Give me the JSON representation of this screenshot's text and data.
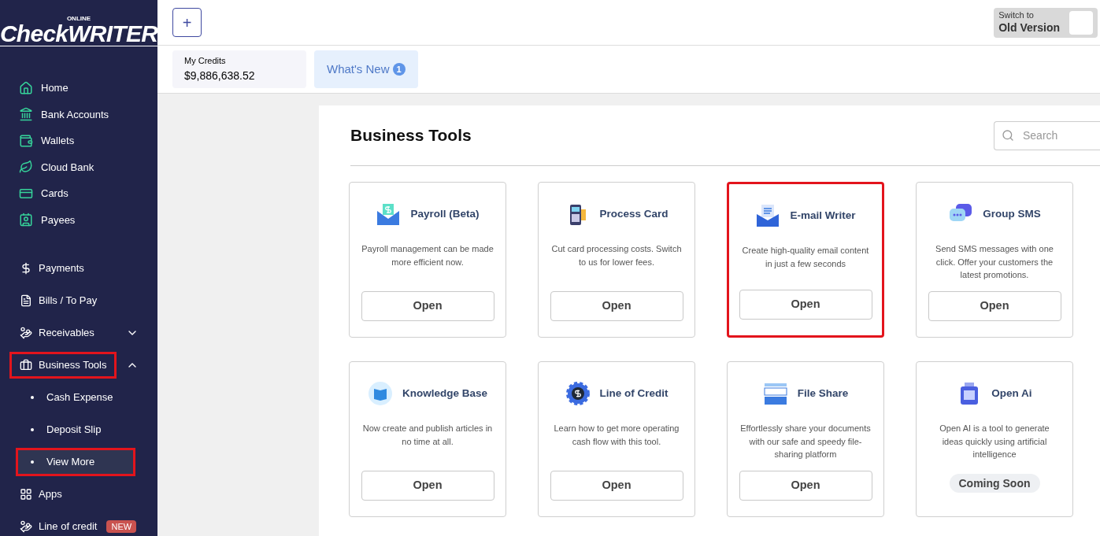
{
  "logo": {
    "small": "ONLINE",
    "main": "CheckWRITER"
  },
  "sidebar": {
    "primary": [
      {
        "label": "Home"
      },
      {
        "label": "Bank Accounts"
      },
      {
        "label": "Wallets"
      },
      {
        "label": "Cloud Bank"
      },
      {
        "label": "Cards"
      },
      {
        "label": "Payees"
      }
    ],
    "secondary": [
      {
        "label": "Payments",
        "kind": "link",
        "highlighted": false
      },
      {
        "label": "Bills / To Pay",
        "kind": "link",
        "highlighted": false
      },
      {
        "label": "Receivables",
        "kind": "group",
        "expanded": false,
        "highlighted": false
      },
      {
        "label": "Business Tools",
        "kind": "group",
        "expanded": true,
        "highlighted": true,
        "children": [
          {
            "label": "Cash Expense",
            "selected": false,
            "highlighted": false
          },
          {
            "label": "Deposit Slip",
            "selected": false,
            "highlighted": false
          },
          {
            "label": "View More",
            "selected": true,
            "highlighted": true
          }
        ]
      },
      {
        "label": "Apps",
        "kind": "link",
        "highlighted": false
      },
      {
        "label": "Line of credit",
        "kind": "link",
        "highlighted": false,
        "badge": "NEW"
      }
    ]
  },
  "topbar": {
    "add_button": "+",
    "switch": {
      "line1": "Switch to",
      "line2": "Old Version"
    }
  },
  "credits": {
    "label": "My Credits",
    "amount": "$9,886,638.52"
  },
  "whats_new": {
    "label": "What's New",
    "count": "1"
  },
  "panel": {
    "title": "Business Tools",
    "search": {
      "placeholder": "Search"
    },
    "tools": [
      {
        "name": "Payroll (Beta)",
        "description": "Payroll management can be made more efficient now.",
        "kind": "open",
        "action": "Open",
        "highlighted": false
      },
      {
        "name": "Process Card",
        "description": "Cut card processing costs. Switch to us for lower fees.",
        "kind": "open",
        "action": "Open",
        "highlighted": false
      },
      {
        "name": "E-mail Writer",
        "description": "Create high-quality email content in just a few seconds",
        "kind": "open",
        "action": "Open",
        "highlighted": true
      },
      {
        "name": "Group SMS",
        "description": "Send SMS messages with one click. Offer your customers the latest promotions.",
        "kind": "open",
        "action": "Open",
        "highlighted": false
      },
      {
        "name": "Knowledge Base",
        "description": "Now create and publish articles in no time at all.",
        "kind": "open",
        "action": "Open",
        "highlighted": false
      },
      {
        "name": "Line of Credit",
        "description": "Learn how to get more operating cash flow with this tool.",
        "kind": "open",
        "action": "Open",
        "highlighted": false
      },
      {
        "name": "File Share",
        "description": "Effortlessly share your documents with our safe and speedy file-sharing platform",
        "kind": "open",
        "action": "Open",
        "highlighted": false
      },
      {
        "name": "Open Ai",
        "description": "Open AI is a tool to generate ideas quickly using artificial intelligence",
        "kind": "coming_soon",
        "action": "Coming Soon",
        "highlighted": false
      }
    ]
  }
}
